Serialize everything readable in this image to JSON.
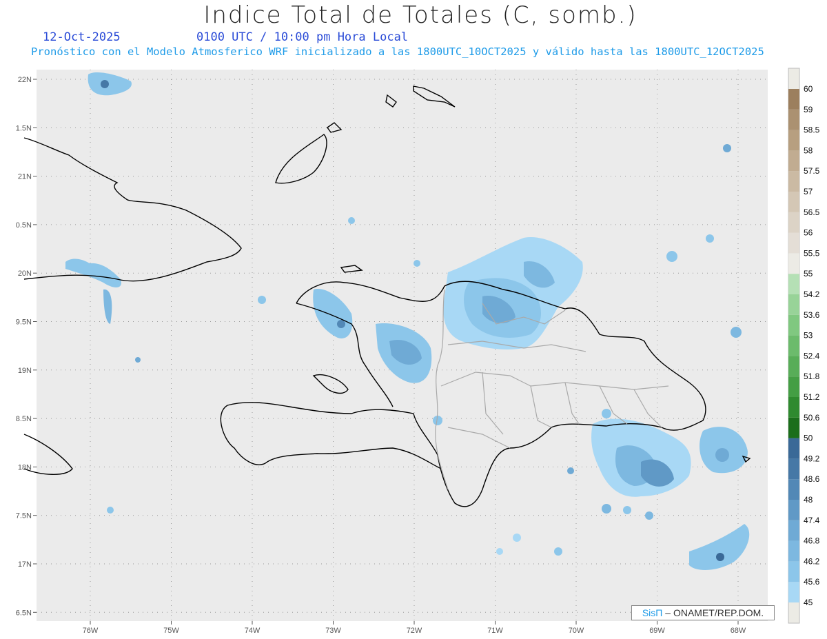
{
  "header": {
    "title": "Indice Total de Totales (C, somb.)",
    "date": "12-Oct-2025",
    "time": "0100 UTC / 10:00 pm Hora Local",
    "description": "Pronóstico con el Modelo Atmosferico WRF inicializado a las 1800UTC_10OCT2025 y válido hasta las  1800UTC_12OCT2025"
  },
  "map": {
    "lon_labels": [
      "76W",
      "75W",
      "74W",
      "73W",
      "72W",
      "71W",
      "70W",
      "69W",
      "68W"
    ],
    "lat_labels": [
      "22N",
      "1.5N",
      "21N",
      "0.5N",
      "20N",
      "9.5N",
      "19N",
      "8.5N",
      "18N",
      "7.5N",
      "17N",
      "6.5N"
    ],
    "background_color": "#ebebeb",
    "grid": "dotted"
  },
  "colorbar": {
    "levels": [
      "45",
      "45.6",
      "46.2",
      "46.8",
      "47.4",
      "48",
      "48.6",
      "49.2",
      "50",
      "50.6",
      "51.2",
      "51.8",
      "52.4",
      "53",
      "53.6",
      "54.2",
      "55",
      "55.5",
      "56",
      "56.5",
      "57",
      "57.5",
      "58",
      "58.5",
      "59",
      "60"
    ],
    "colors": [
      "#a8d8f5",
      "#8cc6ea",
      "#7db8e0",
      "#6faad5",
      "#6099c6",
      "#5288b6",
      "#4678a6",
      "#3a6997",
      "#1b6e1b",
      "#2f8a2f",
      "#449e44",
      "#58ad58",
      "#6cbb6c",
      "#80c880",
      "#98d398",
      "#b5e0b5",
      "#ecebe5",
      "#e4ded6",
      "#dcd3c6",
      "#d4c7b5",
      "#cbbaa3",
      "#c1ac91",
      "#b79f80",
      "#ab9171",
      "#9c7f5e",
      "#ecebe5"
    ]
  },
  "credit": {
    "brand": "SisΠ",
    "text": "– ONAMET/REP.DOM."
  }
}
